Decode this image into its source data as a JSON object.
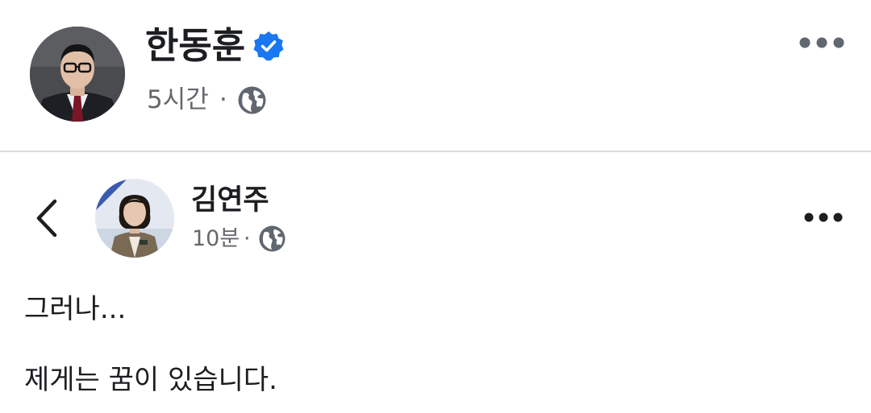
{
  "post": {
    "author": {
      "name": "한동훈",
      "verified": true
    },
    "meta": {
      "time": "5시간",
      "separator": "·",
      "audience_icon": "globe-icon"
    },
    "more_icon": "more-options-icon"
  },
  "shared_post": {
    "back_icon": "chevron-left-icon",
    "author": {
      "name": "김연주"
    },
    "meta": {
      "time": "10분",
      "separator": "·",
      "audience_icon": "globe-icon"
    },
    "more_icon": "more-options-icon",
    "text": {
      "line1": "그러나...",
      "line2": "제게는 꿈이 있습니다."
    }
  },
  "colors": {
    "verified_badge": "#1877f2",
    "text_primary": "#1c1e21",
    "text_secondary": "#65676b",
    "divider": "#dadde1"
  }
}
